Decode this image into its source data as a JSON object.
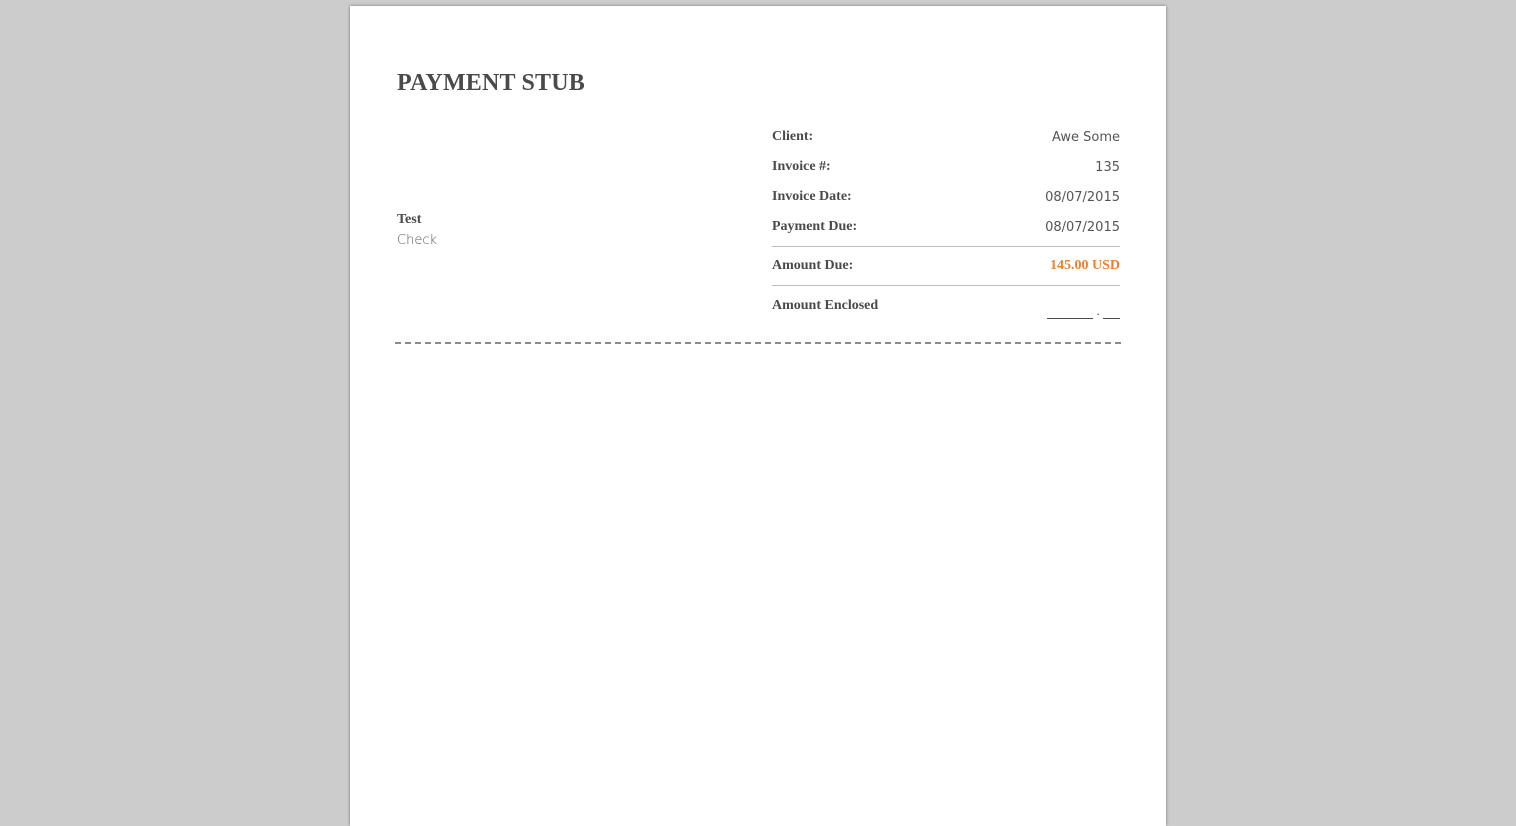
{
  "document": {
    "title": "PAYMENT STUB",
    "payer": {
      "name": "Test",
      "method": "Check"
    },
    "details": {
      "client_label": "Client:",
      "client_value": "Awe Some",
      "invoice_number_label": "Invoice #:",
      "invoice_number_value": "135",
      "invoice_date_label": "Invoice Date:",
      "invoice_date_value": "08/07/2015",
      "payment_due_label": "Payment Due:",
      "payment_due_value": "08/07/2015",
      "amount_due_label": "Amount Due:",
      "amount_due_value": "145.00 USD",
      "amount_enclosed_label": "Amount Enclosed",
      "amount_enclosed_separator": "."
    }
  },
  "colors": {
    "background": "#cccccc",
    "page": "#ffffff",
    "text": "#4a4a4a",
    "accent": "#f07f2c"
  }
}
